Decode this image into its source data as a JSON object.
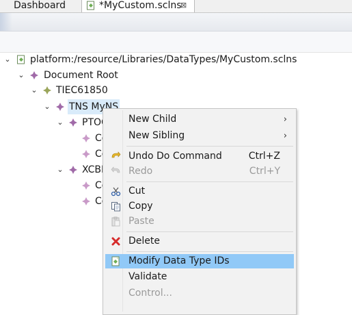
{
  "tabs": {
    "dashboard": "Dashboard",
    "file": "*MyCustom.sclns",
    "close": "⊠"
  },
  "tree": {
    "root": "platform:/resource/Libraries/DataTypes/MyCustom.sclns",
    "document_root": "Document Root",
    "tiec": "TIEC61850",
    "tns": "TNS MyNS",
    "ptoc": "PTOC",
    "ptoc_children": [
      "Co",
      "Co"
    ],
    "xcbr": "XCBR",
    "xcbr_children": [
      "Co",
      "Co"
    ]
  },
  "menu": {
    "new_child": "New Child",
    "new_sibling": "New Sibling",
    "undo": "Undo Do Command",
    "undo_shortcut": "Ctrl+Z",
    "redo": "Redo",
    "redo_shortcut": "Ctrl+Y",
    "cut": "Cut",
    "copy": "Copy",
    "paste": "Paste",
    "delete": "Delete",
    "modify": "Modify Data Type IDs",
    "validate": "Validate",
    "control": "Control..."
  },
  "colors": {
    "menu_highlight": "#91c9f7",
    "selection": "#d9ebfa",
    "node_icon": "#a06aa8",
    "delete_icon": "#d62b2b"
  },
  "icons": {
    "file": "sclns-file-icon",
    "node": "diamond-node-icon",
    "undo": "undo-arrow-icon",
    "redo": "redo-arrow-icon",
    "cut": "scissors-icon",
    "copy": "copy-icon",
    "paste": "paste-icon",
    "delete": "red-x-icon",
    "modify": "modify-ids-icon"
  }
}
